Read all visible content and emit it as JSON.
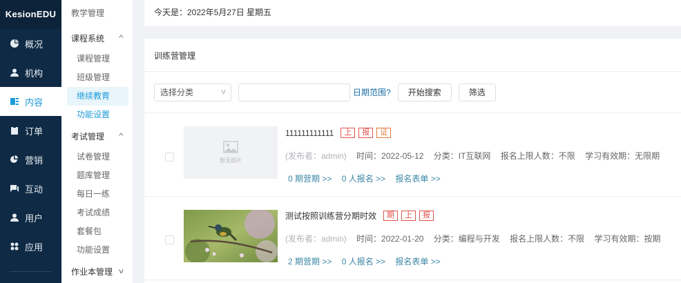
{
  "brand": "KesionEDU",
  "nav": [
    {
      "label": "概况",
      "icon": "pie-chart-icon"
    },
    {
      "label": "机构",
      "icon": "person-icon"
    },
    {
      "label": "内容",
      "icon": "document-icon"
    },
    {
      "label": "订单",
      "icon": "clipboard-icon"
    },
    {
      "label": "营销",
      "icon": "pie-slice-icon"
    },
    {
      "label": "互动",
      "icon": "chat-icon"
    },
    {
      "label": "用户",
      "icon": "user-icon"
    },
    {
      "label": "应用",
      "icon": "grid-icon"
    }
  ],
  "submenu": {
    "title": "教学管理",
    "group1": "课程系统",
    "group1_items": [
      "课程管理",
      "班级管理",
      "继续教育",
      "功能设置"
    ],
    "group2": "考试管理",
    "group2_items": [
      "试卷管理",
      "题库管理",
      "每日一练",
      "考试成绩",
      "套餐包",
      "功能设置"
    ],
    "group3": "作业本管理"
  },
  "datebar": "今天是：2022年5月27日 星期五",
  "panel_title": "训练营管理",
  "filters": {
    "select_label": "选择分类",
    "date_range": "日期范围?",
    "search_btn": "开始搜索",
    "filter_btn": "筛选"
  },
  "rows": [
    {
      "title": "111111111111",
      "tags": [
        "上",
        "报",
        "证"
      ],
      "placeholder_text": "暂无图片",
      "publisher": "(发布者：admin)",
      "time": "时间：2022-05-12",
      "category": "分类：IT互联网",
      "limit": "报名上限人数：不限",
      "validity": "学习有效期：无限期",
      "link1": "0 期营期 >>",
      "link2": "0 人报名 >>",
      "link3": "报名表单 >>"
    },
    {
      "title": "测试按照训练营分期时效",
      "tags": [
        "期",
        "上",
        "报"
      ],
      "publisher": "(发布者：admin)",
      "time": "时间：2022-01-20",
      "category": "分类：编程与开发",
      "limit": "报名上限人数：不限",
      "validity": "学习有效期：按期",
      "link1": "2 期营期 >>",
      "link2": "0 人报名 >>",
      "link3": "报名表单 >>"
    }
  ]
}
